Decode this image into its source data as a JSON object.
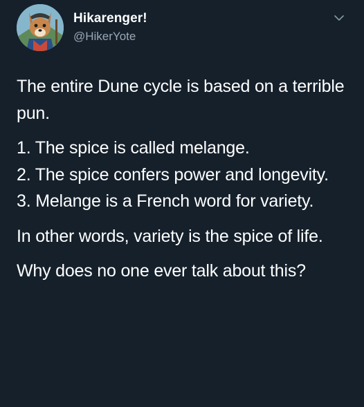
{
  "tweet": {
    "display_name": "Hikarenger!",
    "handle": "@HikerYote",
    "paragraphs": {
      "intro": "The entire Dune cycle is based on a terrible pun.",
      "list": [
        "1. The spice is called melange.",
        "2. The spice confers power and longevity.",
        "3. Melange is a French word for variety."
      ],
      "conclusion": "In other words, variety is the spice of life.",
      "question": "Why does no one ever talk about this?"
    }
  },
  "icons": {
    "avatar": "coyote-hiker-avatar",
    "menu": "chevron-down-icon"
  },
  "colors": {
    "background": "#15202b",
    "text": "#ffffff",
    "secondary": "#9aa8b5"
  }
}
